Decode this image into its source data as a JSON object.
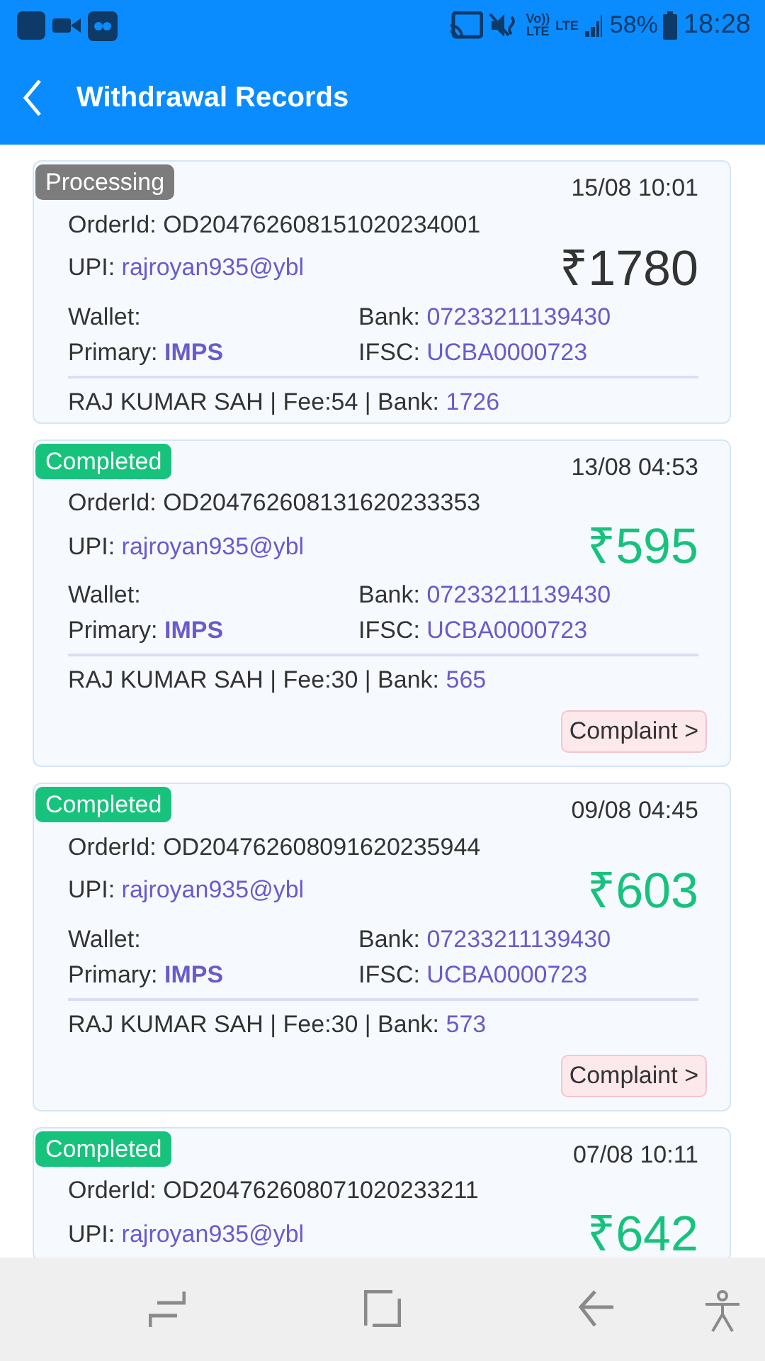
{
  "status_bar": {
    "volte": [
      "Vo))",
      "LTE"
    ],
    "data": "LTE",
    "battery": "58%",
    "time": "18:28"
  },
  "header": {
    "title": "Withdrawal Records"
  },
  "records": [
    {
      "kind": "processing",
      "status": "Processing",
      "date": "15/08 10:01",
      "order_id_label": "OrderId:",
      "order_id": "OD204762608151020234001",
      "upi_label": "UPI:",
      "upi": "rajroyan935@ybl",
      "amount": "₹1780",
      "wallet_label": "Wallet:",
      "primary_label": "Primary:",
      "primary": "IMPS",
      "bank_label": "Bank:",
      "bank": "07233211139430",
      "ifsc_label": "IFSC:",
      "ifsc": "UCBA0000723",
      "footer": "RAJ KUMAR SAH | Fee:54 | Bank:",
      "footer_amount": "1726"
    },
    {
      "kind": "completed",
      "status": "Completed",
      "date": "13/08 04:53",
      "order_id_label": "OrderId:",
      "order_id": "OD204762608131620233353",
      "upi_label": "UPI:",
      "upi": "rajroyan935@ybl",
      "amount": "₹595",
      "wallet_label": "Wallet:",
      "primary_label": "Primary:",
      "primary": "IMPS",
      "bank_label": "Bank:",
      "bank": "07233211139430",
      "ifsc_label": "IFSC:",
      "ifsc": "UCBA0000723",
      "footer": "RAJ KUMAR SAH | Fee:30 | Bank:",
      "footer_amount": "565",
      "complaint": "Complaint >"
    },
    {
      "kind": "completed",
      "status": "Completed",
      "date": "09/08 04:45",
      "order_id_label": "OrderId:",
      "order_id": "OD204762608091620235944",
      "upi_label": "UPI:",
      "upi": "rajroyan935@ybl",
      "amount": "₹603",
      "wallet_label": "Wallet:",
      "primary_label": "Primary:",
      "primary": "IMPS",
      "bank_label": "Bank:",
      "bank": "07233211139430",
      "ifsc_label": "IFSC:",
      "ifsc": "UCBA0000723",
      "footer": "RAJ KUMAR SAH | Fee:30 | Bank:",
      "footer_amount": "573",
      "complaint": "Complaint >"
    },
    {
      "kind": "completed",
      "status": "Completed",
      "date": "07/08 10:11",
      "order_id_label": "OrderId:",
      "order_id": "OD204762608071020233211",
      "upi_label": "UPI:",
      "upi": "rajroyan935@ybl",
      "amount": "₹642"
    }
  ]
}
